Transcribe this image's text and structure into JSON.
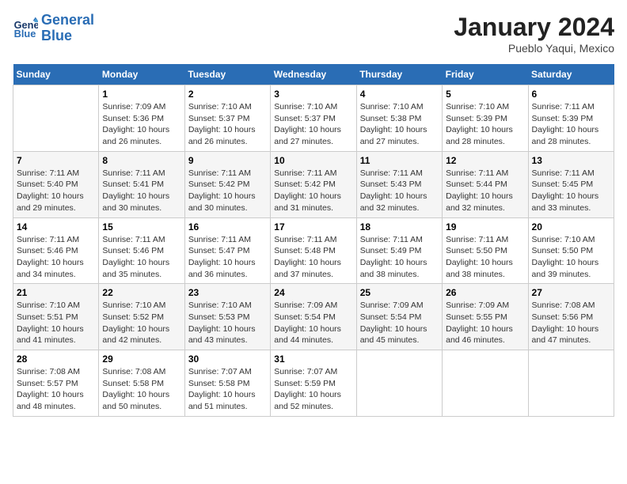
{
  "header": {
    "logo_line1": "General",
    "logo_line2": "Blue",
    "month_year": "January 2024",
    "location": "Pueblo Yaqui, Mexico"
  },
  "days_of_week": [
    "Sunday",
    "Monday",
    "Tuesday",
    "Wednesday",
    "Thursday",
    "Friday",
    "Saturday"
  ],
  "weeks": [
    [
      {
        "day": "",
        "sunrise": "",
        "sunset": "",
        "daylight": ""
      },
      {
        "day": "1",
        "sunrise": "7:09 AM",
        "sunset": "5:36 PM",
        "daylight": "10 hours and 26 minutes."
      },
      {
        "day": "2",
        "sunrise": "7:10 AM",
        "sunset": "5:37 PM",
        "daylight": "10 hours and 26 minutes."
      },
      {
        "day": "3",
        "sunrise": "7:10 AM",
        "sunset": "5:37 PM",
        "daylight": "10 hours and 27 minutes."
      },
      {
        "day": "4",
        "sunrise": "7:10 AM",
        "sunset": "5:38 PM",
        "daylight": "10 hours and 27 minutes."
      },
      {
        "day": "5",
        "sunrise": "7:10 AM",
        "sunset": "5:39 PM",
        "daylight": "10 hours and 28 minutes."
      },
      {
        "day": "6",
        "sunrise": "7:11 AM",
        "sunset": "5:39 PM",
        "daylight": "10 hours and 28 minutes."
      }
    ],
    [
      {
        "day": "7",
        "sunrise": "7:11 AM",
        "sunset": "5:40 PM",
        "daylight": "10 hours and 29 minutes."
      },
      {
        "day": "8",
        "sunrise": "7:11 AM",
        "sunset": "5:41 PM",
        "daylight": "10 hours and 30 minutes."
      },
      {
        "day": "9",
        "sunrise": "7:11 AM",
        "sunset": "5:42 PM",
        "daylight": "10 hours and 30 minutes."
      },
      {
        "day": "10",
        "sunrise": "7:11 AM",
        "sunset": "5:42 PM",
        "daylight": "10 hours and 31 minutes."
      },
      {
        "day": "11",
        "sunrise": "7:11 AM",
        "sunset": "5:43 PM",
        "daylight": "10 hours and 32 minutes."
      },
      {
        "day": "12",
        "sunrise": "7:11 AM",
        "sunset": "5:44 PM",
        "daylight": "10 hours and 32 minutes."
      },
      {
        "day": "13",
        "sunrise": "7:11 AM",
        "sunset": "5:45 PM",
        "daylight": "10 hours and 33 minutes."
      }
    ],
    [
      {
        "day": "14",
        "sunrise": "7:11 AM",
        "sunset": "5:46 PM",
        "daylight": "10 hours and 34 minutes."
      },
      {
        "day": "15",
        "sunrise": "7:11 AM",
        "sunset": "5:46 PM",
        "daylight": "10 hours and 35 minutes."
      },
      {
        "day": "16",
        "sunrise": "7:11 AM",
        "sunset": "5:47 PM",
        "daylight": "10 hours and 36 minutes."
      },
      {
        "day": "17",
        "sunrise": "7:11 AM",
        "sunset": "5:48 PM",
        "daylight": "10 hours and 37 minutes."
      },
      {
        "day": "18",
        "sunrise": "7:11 AM",
        "sunset": "5:49 PM",
        "daylight": "10 hours and 38 minutes."
      },
      {
        "day": "19",
        "sunrise": "7:11 AM",
        "sunset": "5:50 PM",
        "daylight": "10 hours and 38 minutes."
      },
      {
        "day": "20",
        "sunrise": "7:10 AM",
        "sunset": "5:50 PM",
        "daylight": "10 hours and 39 minutes."
      }
    ],
    [
      {
        "day": "21",
        "sunrise": "7:10 AM",
        "sunset": "5:51 PM",
        "daylight": "10 hours and 41 minutes."
      },
      {
        "day": "22",
        "sunrise": "7:10 AM",
        "sunset": "5:52 PM",
        "daylight": "10 hours and 42 minutes."
      },
      {
        "day": "23",
        "sunrise": "7:10 AM",
        "sunset": "5:53 PM",
        "daylight": "10 hours and 43 minutes."
      },
      {
        "day": "24",
        "sunrise": "7:09 AM",
        "sunset": "5:54 PM",
        "daylight": "10 hours and 44 minutes."
      },
      {
        "day": "25",
        "sunrise": "7:09 AM",
        "sunset": "5:54 PM",
        "daylight": "10 hours and 45 minutes."
      },
      {
        "day": "26",
        "sunrise": "7:09 AM",
        "sunset": "5:55 PM",
        "daylight": "10 hours and 46 minutes."
      },
      {
        "day": "27",
        "sunrise": "7:08 AM",
        "sunset": "5:56 PM",
        "daylight": "10 hours and 47 minutes."
      }
    ],
    [
      {
        "day": "28",
        "sunrise": "7:08 AM",
        "sunset": "5:57 PM",
        "daylight": "10 hours and 48 minutes."
      },
      {
        "day": "29",
        "sunrise": "7:08 AM",
        "sunset": "5:58 PM",
        "daylight": "10 hours and 50 minutes."
      },
      {
        "day": "30",
        "sunrise": "7:07 AM",
        "sunset": "5:58 PM",
        "daylight": "10 hours and 51 minutes."
      },
      {
        "day": "31",
        "sunrise": "7:07 AM",
        "sunset": "5:59 PM",
        "daylight": "10 hours and 52 minutes."
      },
      {
        "day": "",
        "sunrise": "",
        "sunset": "",
        "daylight": ""
      },
      {
        "day": "",
        "sunrise": "",
        "sunset": "",
        "daylight": ""
      },
      {
        "day": "",
        "sunrise": "",
        "sunset": "",
        "daylight": ""
      }
    ]
  ],
  "labels": {
    "sunrise_prefix": "Sunrise: ",
    "sunset_prefix": "Sunset: ",
    "daylight_prefix": "Daylight: "
  }
}
